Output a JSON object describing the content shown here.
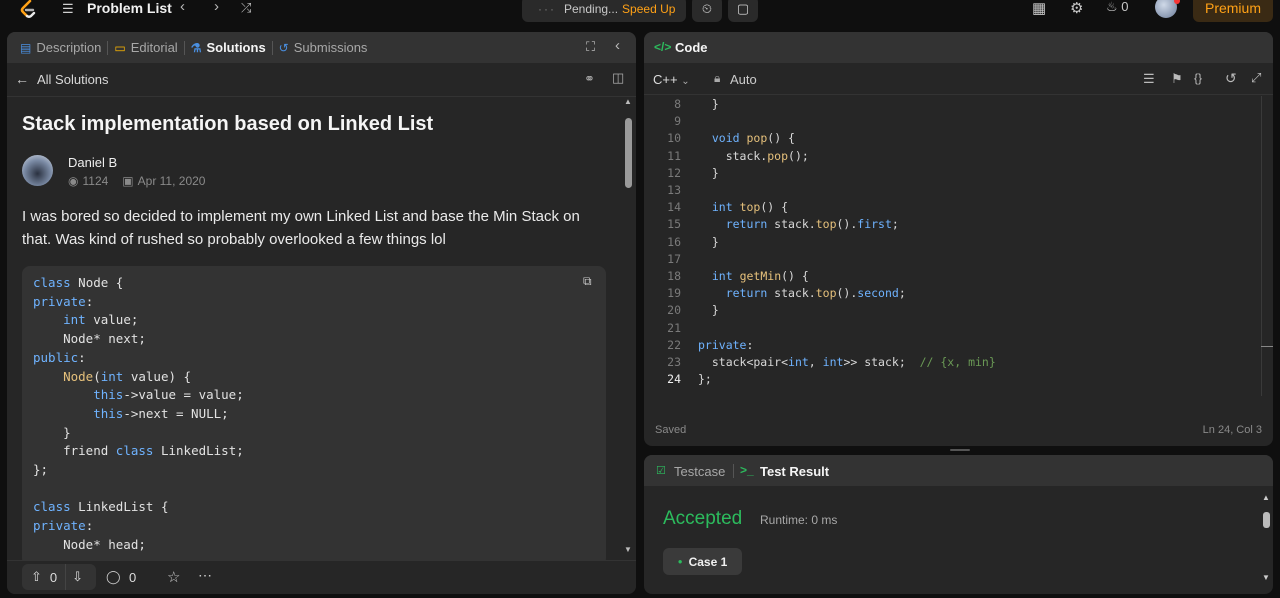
{
  "topbar": {
    "problem_list": "Problem List",
    "pending": "Pending...",
    "speed_up": "Speed Up",
    "streak_count": "0",
    "premium": "Premium"
  },
  "left_panel": {
    "tabs": [
      {
        "label": "Description",
        "icon": "document-icon"
      },
      {
        "label": "Editorial",
        "icon": "book-icon"
      },
      {
        "label": "Solutions",
        "icon": "flask-icon",
        "active": true
      },
      {
        "label": "Submissions",
        "icon": "history-icon"
      }
    ],
    "back_label": "All Solutions",
    "title": "Stack implementation based on Linked List",
    "author": "Daniel B",
    "views": "1124",
    "date": "Apr 11, 2020",
    "description": "I was bored so decided to implement my own Linked List and base the Min Stack on that. Was kind of rushed so probably overlooked a few things lol",
    "upvotes": "0",
    "comments": "0"
  },
  "code_panel": {
    "title": "Code",
    "language": "C++",
    "mode": "Auto",
    "status": "Saved",
    "cursor": "Ln 24, Col 3"
  },
  "test_panel": {
    "tab_testcase": "Testcase",
    "tab_result": "Test Result",
    "verdict": "Accepted",
    "runtime": "Runtime: 0 ms",
    "case_label": "Case 1"
  },
  "colors": {
    "accent": "#ffa116",
    "accepted": "#2cbb5d",
    "panel": "#262626",
    "keyword": "#6fb3ff"
  }
}
